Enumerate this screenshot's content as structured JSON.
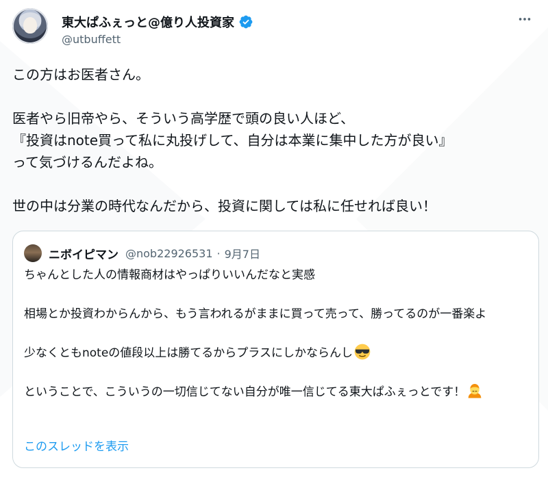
{
  "header": {
    "display_name": "東大ぱふぇっと@億り人投資家",
    "handle": "@utbuffett"
  },
  "tweet": {
    "text": "この方はお医者さん。\n\n医者やら旧帝やら、そういう高学歴で頭の良い人ほど、\n『投資はnote買って私に丸投げして、自分は本業に集中した方が良い』\nって気づけるんだよね。\n\n世の中は分業の時代なんだから、投資に関しては私に任せれば良い！"
  },
  "quoted": {
    "display_name": "ニボイピマン",
    "handle": "@nob22926531",
    "separator": "·",
    "date": "9月7日",
    "text_1": "ちゃんとした人の情報商材はやっぱりいいんだなと実感\n\n相場とか投資わからんから、もう言われるがままに買って売って、勝ってるのが一番楽よ\n\n少なくともnoteの値段以上は勝てるからプラスにしかならんし",
    "text_2": "\n\nということで、こういうの一切信じてない自分が唯一信じてる東大ぱふぇっとです！",
    "show_thread": "このスレッドを表示"
  },
  "icons": {
    "verified": "verified-badge-icon",
    "more": "more-options-icon",
    "sunglasses_emoji": "smiling-face-with-sunglasses-icon",
    "person_emoji": "person-bowing-icon"
  },
  "colors": {
    "accent": "#1d9bf0",
    "text": "#0f1419",
    "secondary": "#536471",
    "border": "#cfd9de"
  }
}
